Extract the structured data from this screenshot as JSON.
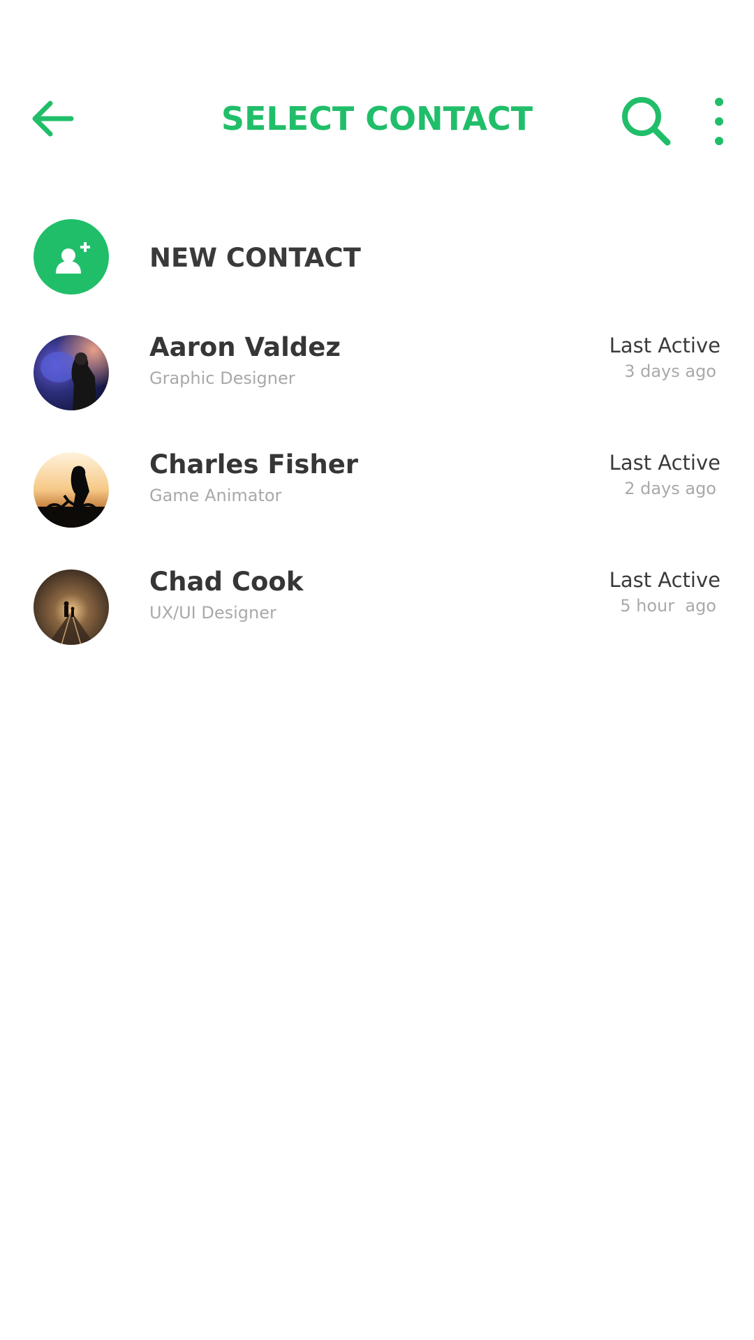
{
  "header": {
    "title": "SELECT CONTACT",
    "back_icon": "arrow-left-icon",
    "search_icon": "search-icon",
    "more_icon": "more-vertical-icon"
  },
  "new_contact": {
    "label": "NEW CONTACT",
    "icon": "add-person-icon"
  },
  "contacts": [
    {
      "name": "Aaron Valdez",
      "role": "Graphic Designer",
      "active_label": "Last Active",
      "active_time": "3 days ago"
    },
    {
      "name": "Charles Fisher",
      "role": "Game Animator",
      "active_label": "Last Active",
      "active_time": "2 days ago"
    },
    {
      "name": "Chad Cook",
      "role": "UX/UI Designer",
      "active_label": "Last Active",
      "active_time": "5 hour  ago"
    }
  ],
  "colors": {
    "accent": "#21BE6A",
    "text_primary": "#363636",
    "text_secondary": "#a9a9a9",
    "background": "#ffffff"
  }
}
